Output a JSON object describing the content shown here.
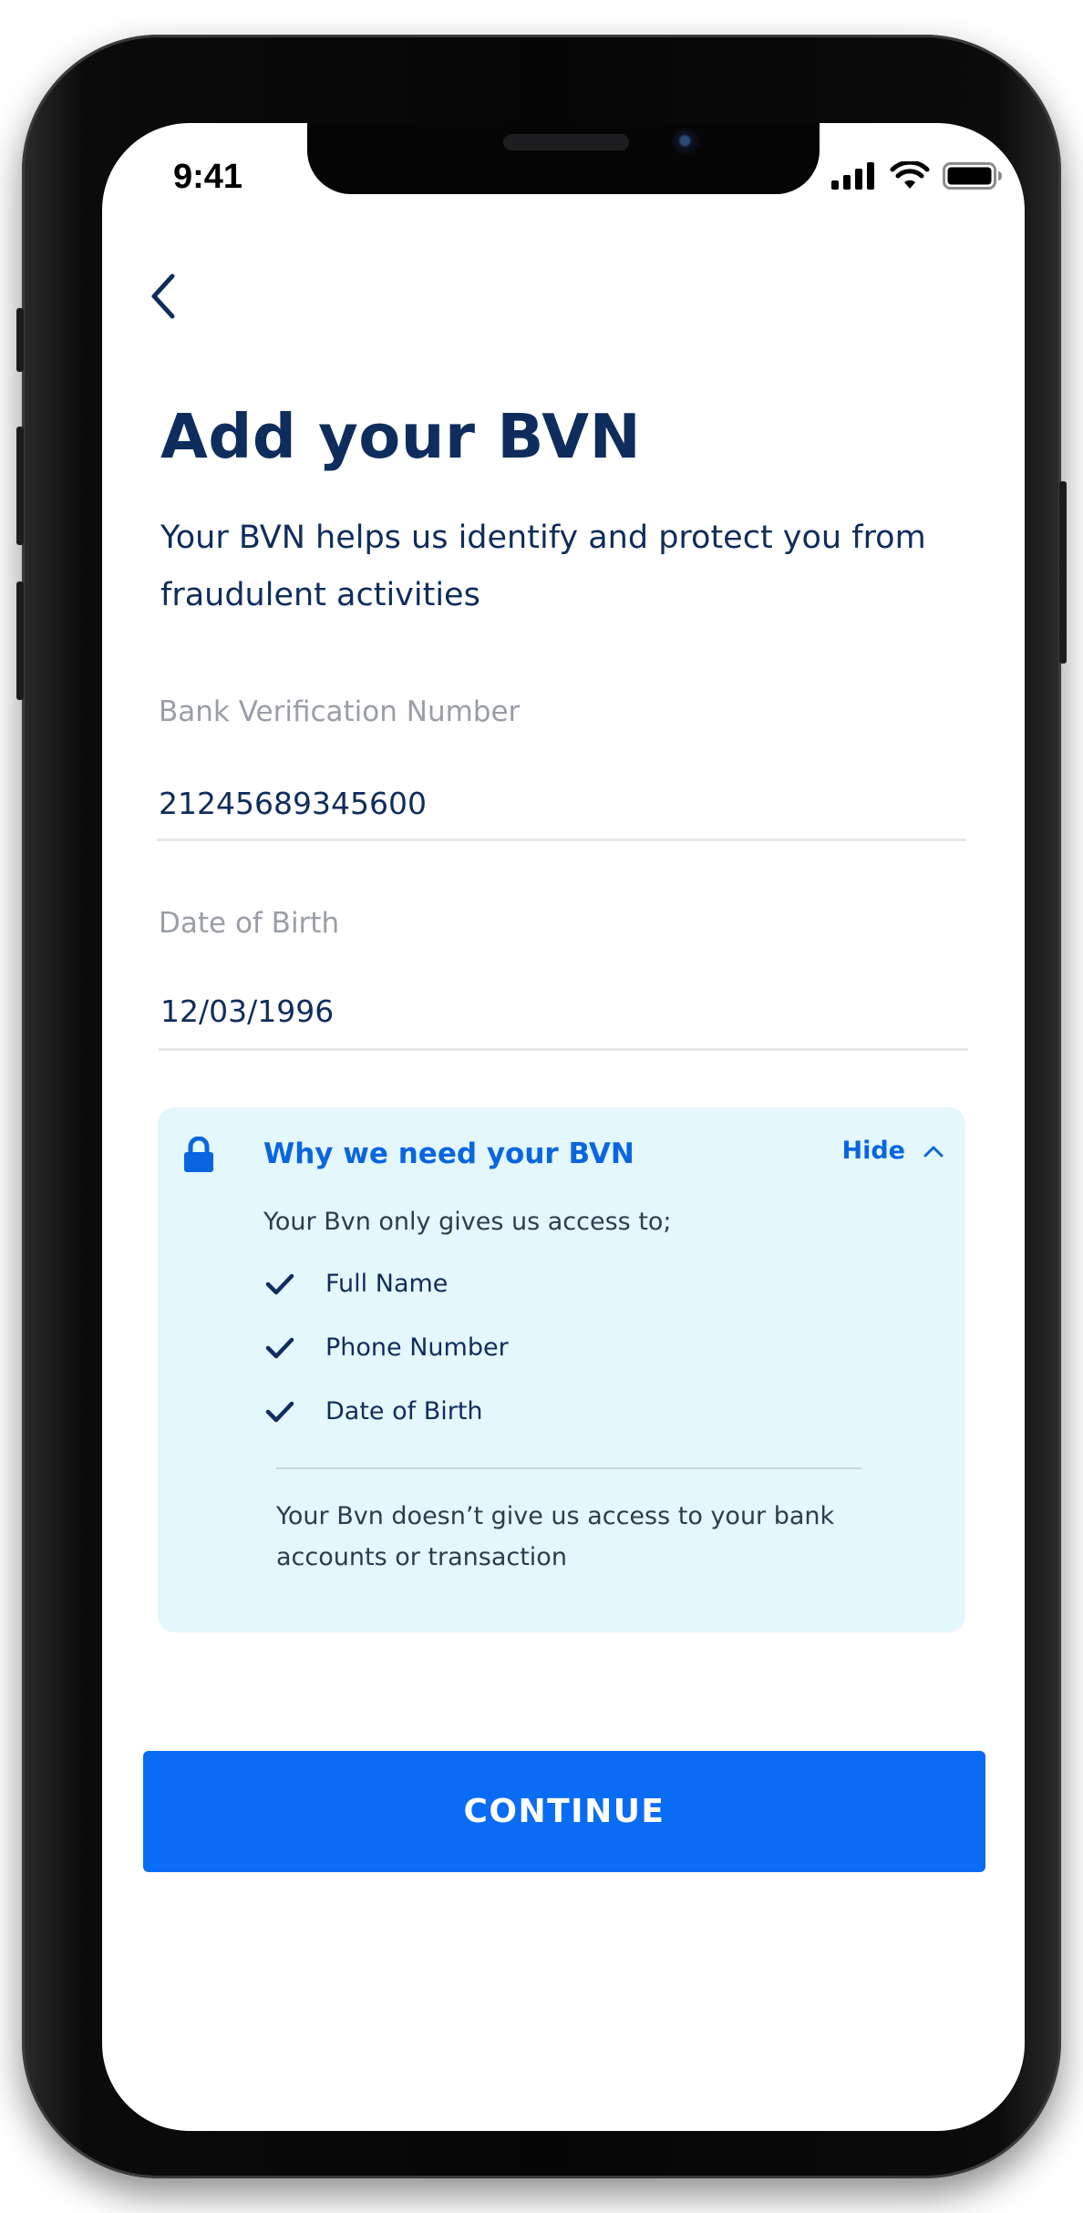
{
  "status_bar": {
    "time": "9:41"
  },
  "page": {
    "title": "Add your BVN",
    "subtitle": "Your BVN helps us identify and protect you from fraudulent activities"
  },
  "form": {
    "bvn": {
      "label": "Bank Verification Number",
      "value": "21245689345600"
    },
    "dob": {
      "label": "Date of Birth",
      "value": "12/03/1996"
    }
  },
  "info_card": {
    "title": "Why we need your BVN",
    "toggle_label": "Hide",
    "intro": "Your Bvn only gives us access to;",
    "items": [
      {
        "label": "Full Name"
      },
      {
        "label": "Phone Number"
      },
      {
        "label": "Date of Birth"
      }
    ],
    "note": "Your Bvn doesn’t give us access to your bank accounts or transaction"
  },
  "actions": {
    "continue_label": "CONTINUE"
  },
  "colors": {
    "primary": "#0a6cf5",
    "heading": "#0f2d5c",
    "card_bg": "#e4f7fc",
    "muted": "#9a9ea6"
  },
  "icons": {
    "back": "chevron-left-icon",
    "lock": "lock-icon",
    "toggle": "chevron-up-icon",
    "check": "check-icon"
  }
}
